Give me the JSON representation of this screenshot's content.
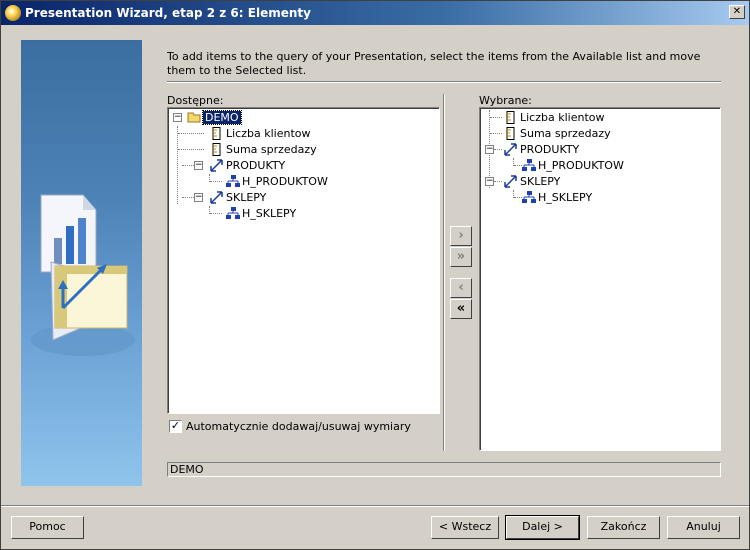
{
  "window": {
    "title": "Presentation Wizard, etap 2 z 6: Elementy",
    "close_glyph": "✕"
  },
  "instructions": "To add items to the query of your Presentation, select the items from the Available list and move them to the Selected list.",
  "available": {
    "label": "Dostępne:",
    "root": "DEMO",
    "items": [
      "Liczba klientow",
      "Suma sprzedazy",
      "PRODUKTY",
      "H_PRODUKTOW",
      "SKLEPY",
      "H_SKLEPY"
    ]
  },
  "selected": {
    "label": "Wybrane:",
    "items": [
      "Liczba klientow",
      "Suma sprzedazy",
      "PRODUKTY",
      "H_PRODUKTOW",
      "SKLEPY",
      "H_SKLEPY"
    ]
  },
  "move_buttons": {
    "add": "›",
    "add_all": "»",
    "remove": "‹",
    "remove_all": "«"
  },
  "auto_checkbox": {
    "label": "Automatycznie dodawaj/usuwaj wymiary",
    "checked": true,
    "mark": "✓"
  },
  "status_path": "DEMO",
  "buttons": {
    "help": "Pomoc",
    "back": "< Wstecz",
    "next": "Dalej >",
    "finish": "Zakończ",
    "cancel": "Anuluj"
  },
  "expander": {
    "minus": "−"
  },
  "icons": {
    "folder": "folder-icon",
    "measure": "measure-icon",
    "dimension": "dimension-icon",
    "hierarchy": "hierarchy-icon"
  }
}
